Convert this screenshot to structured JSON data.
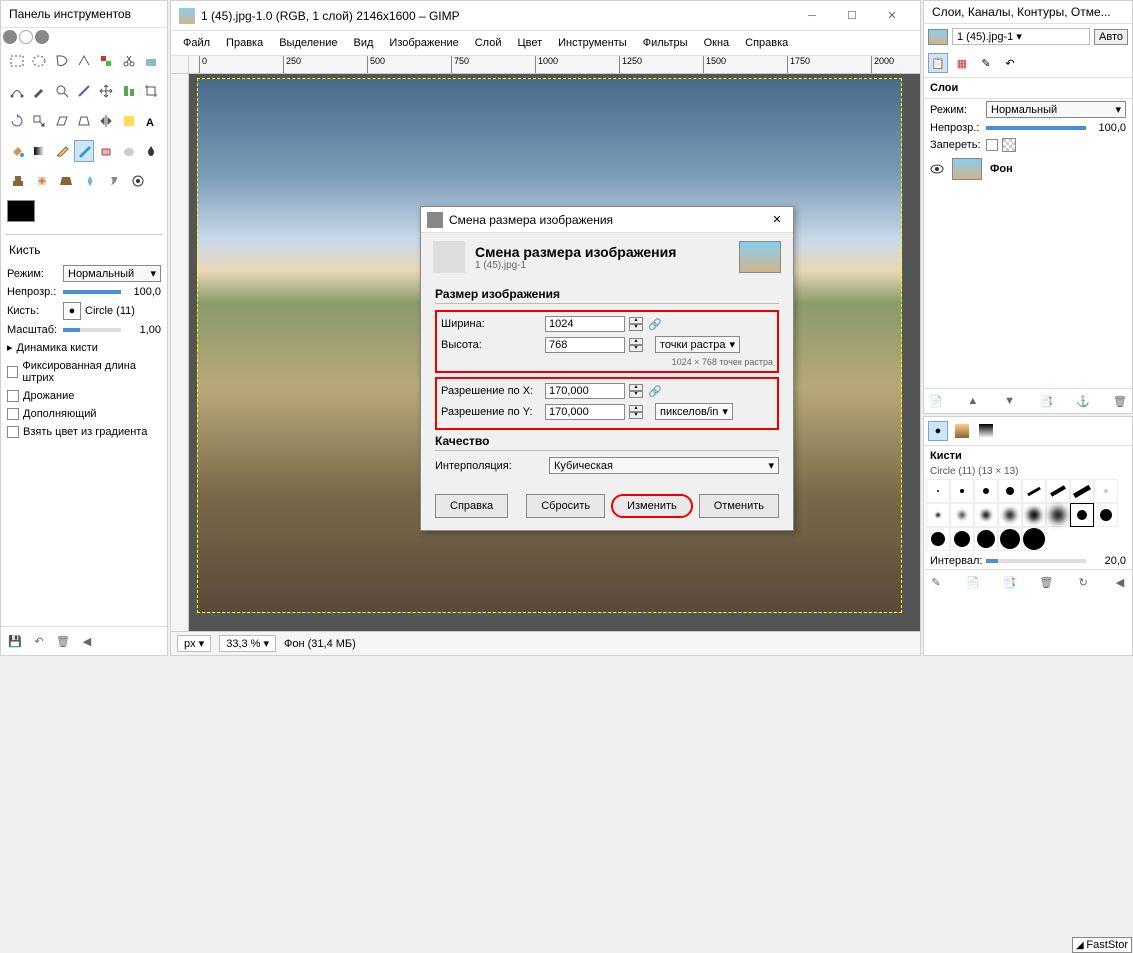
{
  "toolbox": {
    "title": "Панель инструментов",
    "brush_section": "Кисть",
    "mode_label": "Режим:",
    "mode_value": "Нормальный",
    "opacity_label": "Непрозр.:",
    "opacity_value": "100,0",
    "brush_label": "Кисть:",
    "brush_value": "Circle (11)",
    "scale_label": "Масштаб:",
    "scale_value": "1,00",
    "dynamics": "Динамика кисти",
    "fixed_len": "Фиксированная длина штрих",
    "jitter": "Дрожание",
    "incremental": "Дополняющий",
    "gradient_color": "Взять цвет из градиента"
  },
  "main": {
    "title": "1 (45).jpg-1.0 (RGB, 1 слой) 2146x1600 – GIMP",
    "menus": [
      "Файл",
      "Правка",
      "Выделение",
      "Вид",
      "Изображение",
      "Слой",
      "Цвет",
      "Инструменты",
      "Фильтры",
      "Окна",
      "Справка"
    ],
    "ruler_ticks": [
      "0",
      "250",
      "500",
      "750",
      "1000",
      "1250",
      "1500",
      "1750",
      "2000"
    ],
    "status_unit": "px",
    "status_zoom": "33,3 %",
    "status_info": "Фон (31,4 МБ)"
  },
  "dialog": {
    "window_title": "Смена размера изображения",
    "header_title": "Смена размера изображения",
    "header_sub": "1 (45).jpg-1",
    "size_section": "Размер изображения",
    "width_label": "Ширина:",
    "width_value": "1024",
    "height_label": "Высота:",
    "height_value": "768",
    "hint": "1024 × 768 точек растра",
    "unit_px": "точки растра",
    "resx_label": "Разрешение по X:",
    "resx_value": "170,000",
    "resy_label": "Разрешение по Y:",
    "resy_value": "170,000",
    "res_unit": "пикселов/in",
    "quality_section": "Качество",
    "interp_label": "Интерполяция:",
    "interp_value": "Кубическая",
    "btn_help": "Справка",
    "btn_reset": "Сбросить",
    "btn_change": "Изменить",
    "btn_cancel": "Отменить"
  },
  "layers_panel": {
    "title": "Слои, Каналы, Контуры, Отме...",
    "image_name": "1 (45).jpg-1",
    "auto": "Авто",
    "section": "Слои",
    "mode_label": "Режим:",
    "mode_value": "Нормальный",
    "opacity_label": "Непрозр.:",
    "opacity_value": "100,0",
    "lock_label": "Запереть:",
    "layer_name": "Фон"
  },
  "brushes_panel": {
    "section": "Кисти",
    "brush_name": "Circle (11) (13 × 13)",
    "interval_label": "Интервал:",
    "interval_value": "20,0"
  },
  "faststone": "FastStor"
}
